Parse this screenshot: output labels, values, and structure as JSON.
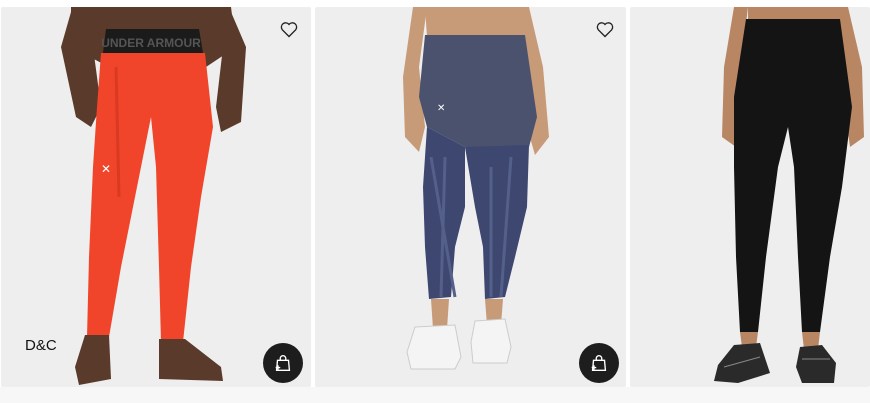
{
  "products": [
    {
      "brand_label": "D&C",
      "wishlist_icon": "heart-outline-icon",
      "cart_icon": "shopping-bag-plus-icon",
      "legging_color": "#f0452a",
      "waistband_text": "UNDER ARMOUR"
    },
    {
      "wishlist_icon": "heart-outline-icon",
      "cart_icon": "shopping-bag-plus-icon",
      "legging_color": "#4a526e"
    },
    {
      "legging_color": "#141414"
    }
  ],
  "colors": {
    "card_bg": "#eeeeee",
    "button_bg": "#1d1d1d"
  }
}
